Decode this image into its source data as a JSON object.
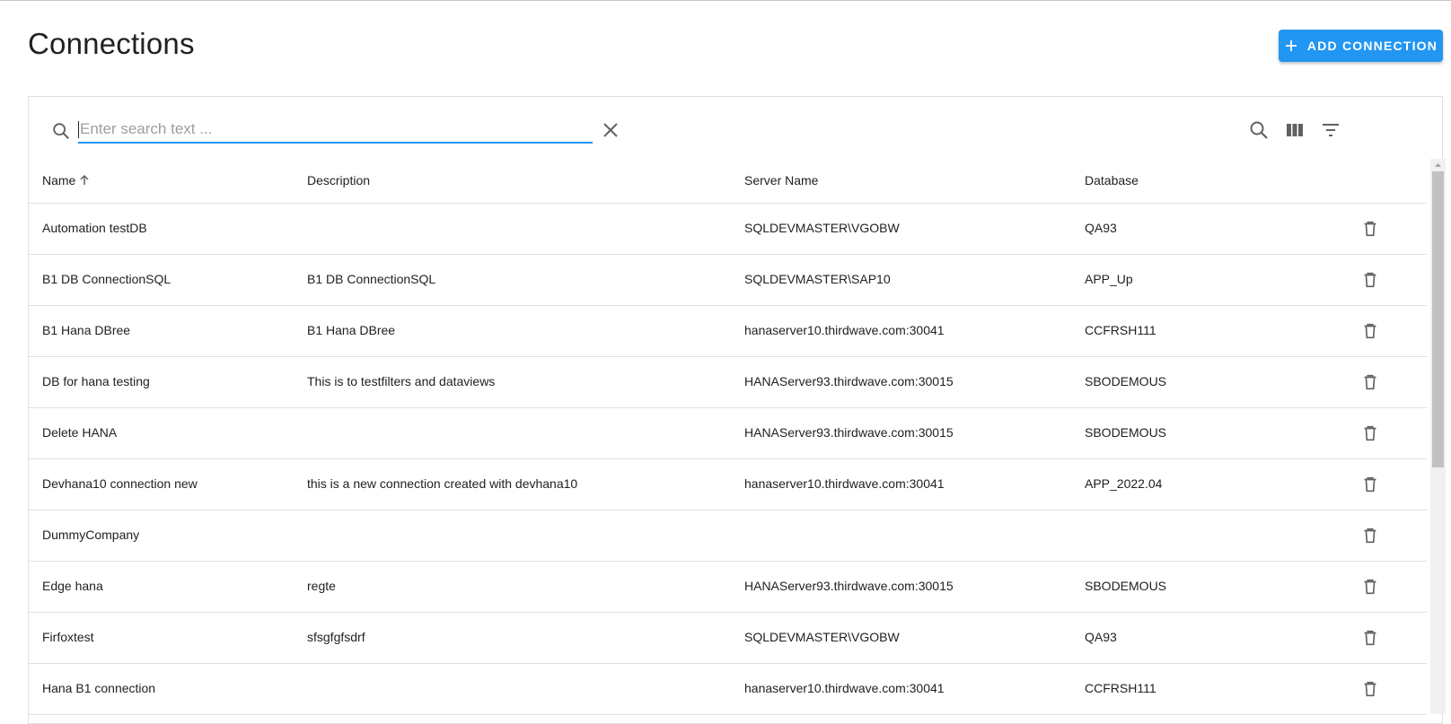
{
  "header": {
    "title": "Connections",
    "add_button_label": "ADD CONNECTION"
  },
  "search": {
    "placeholder": "Enter search text ...",
    "value": ""
  },
  "table": {
    "columns": {
      "name": "Name",
      "description": "Description",
      "server_name": "Server Name",
      "database": "Database"
    },
    "sort": {
      "column": "Name",
      "direction": "ascending"
    },
    "rows": [
      {
        "name": "Automation testDB",
        "description": "",
        "server_name": "SQLDEVMASTER\\VGOBW",
        "database": "QA93"
      },
      {
        "name": "B1 DB ConnectionSQL",
        "description": "B1 DB ConnectionSQL",
        "server_name": "SQLDEVMASTER\\SAP10",
        "database": "APP_Up"
      },
      {
        "name": "B1 Hana DBree",
        "description": "B1 Hana DBree",
        "server_name": "hanaserver10.thirdwave.com:30041",
        "database": "CCFRSH111"
      },
      {
        "name": "DB for hana testing",
        "description": "This is to testfilters and dataviews",
        "server_name": "HANAServer93.thirdwave.com:30015",
        "database": "SBODEMOUS"
      },
      {
        "name": "Delete HANA",
        "description": "",
        "server_name": "HANAServer93.thirdwave.com:30015",
        "database": "SBODEMOUS"
      },
      {
        "name": "Devhana10 connection new",
        "description": "this is a new connection created with devhana10",
        "server_name": "hanaserver10.thirdwave.com:30041",
        "database": "APP_2022.04"
      },
      {
        "name": "DummyCompany",
        "description": "",
        "server_name": "",
        "database": ""
      },
      {
        "name": "Edge hana",
        "description": "regte",
        "server_name": "HANAServer93.thirdwave.com:30015",
        "database": "SBODEMOUS"
      },
      {
        "name": "Firfoxtest",
        "description": "sfsgfgfsdrf",
        "server_name": "SQLDEVMASTER\\VGOBW",
        "database": "QA93"
      },
      {
        "name": "Hana B1 connection",
        "description": "",
        "server_name": "hanaserver10.thirdwave.com:30041",
        "database": "CCFRSH111"
      }
    ]
  },
  "icons": {
    "search_left": "search-icon",
    "clear": "close-icon",
    "toolbar_search": "search-icon",
    "columns": "view-column-icon",
    "filter": "filter-list-icon",
    "row_delete": "trash-icon",
    "sort": "arrow-up-icon",
    "add": "plus-icon"
  },
  "colors": {
    "accent": "#2196f3",
    "text": "#212121",
    "icon": "#616161",
    "divider": "#e0e0e0"
  }
}
